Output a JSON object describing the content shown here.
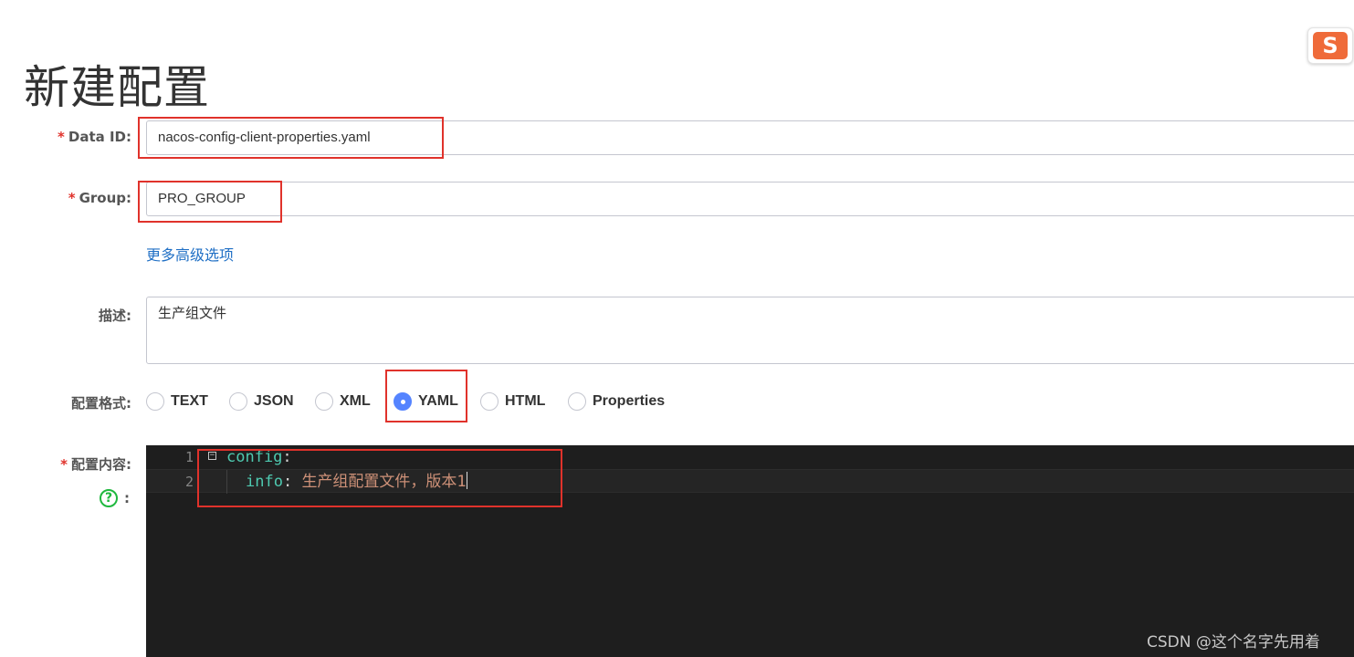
{
  "page": {
    "title": "新建配置"
  },
  "form": {
    "data_id": {
      "label": "Data ID:",
      "value": "nacos-config-client-properties.yaml"
    },
    "group": {
      "label": "Group:",
      "value": "PRO_GROUP"
    },
    "advanced_link": "更多高级选项",
    "description": {
      "label": "描述:",
      "value": "生产组文件"
    },
    "format": {
      "label": "配置格式:",
      "selected": "YAML",
      "options": [
        "TEXT",
        "JSON",
        "XML",
        "YAML",
        "HTML",
        "Properties"
      ]
    },
    "content": {
      "label": "配置内容:",
      "help_colon": ":",
      "lines": [
        {
          "num": "1",
          "key": "config",
          "sep": ":",
          "value": ""
        },
        {
          "num": "2",
          "key": "info",
          "sep": ": ",
          "value": "生产组配置文件，版本1"
        }
      ]
    }
  },
  "required_mark": "*",
  "watermark": "CSDN @这个名字先用着",
  "colors": {
    "required": "#e0322b",
    "link": "#1f6fc5",
    "radio_checked": "#5584ff",
    "editor_bg": "#1e1e1e",
    "highlight_box": "#e0322b"
  },
  "icons": {
    "ime_logo": "sogou-s-icon",
    "help": "question-circle-icon",
    "fold": "fold-minus-icon"
  },
  "ime_logo_letter": "S"
}
